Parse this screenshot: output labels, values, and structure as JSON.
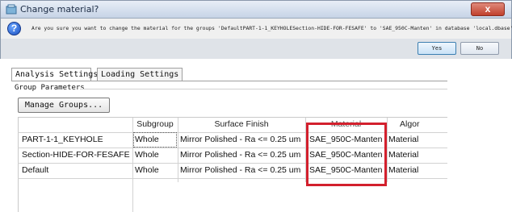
{
  "dialog": {
    "title": "Change material?",
    "message": "Are you sure you want to change the material for the groups 'DefaultPART-1-1_KEYHOLESection-HIDE-FOR-FESAFE' to 'SAE_950C-Manten' in database 'local.dbase'?",
    "yes_label": "Yes",
    "no_label": "No",
    "close_glyph": "x"
  },
  "tabs": [
    "Analysis Settings",
    "Loading Settings"
  ],
  "group_parameters_label": "Group Parameters",
  "manage_groups_label": "Manage Groups...",
  "table": {
    "columns": [
      "",
      "Subgroup",
      "Surface Finish",
      "Material",
      "Algor"
    ],
    "rows": [
      {
        "name": "PART-1-1_KEYHOLE",
        "subgroup": "Whole",
        "surface": "Mirror Polished - Ra <= 0.25 um",
        "material": "SAE_950C-Manten",
        "algorithm": "Material"
      },
      {
        "name": "Section-HIDE-FOR-FESAFE",
        "subgroup": "Whole",
        "surface": "Mirror Polished - Ra <= 0.25 um",
        "material": "SAE_950C-Manten",
        "algorithm": "Material"
      },
      {
        "name": "Default",
        "subgroup": "Whole",
        "surface": "Mirror Polished - Ra <= 0.25 um",
        "material": "SAE_950C-Manten",
        "algorithm": "Material"
      }
    ]
  },
  "colors": {
    "highlight": "#d3202d",
    "titlebar": "#c6d3e6",
    "close_button": "#c0402c"
  }
}
